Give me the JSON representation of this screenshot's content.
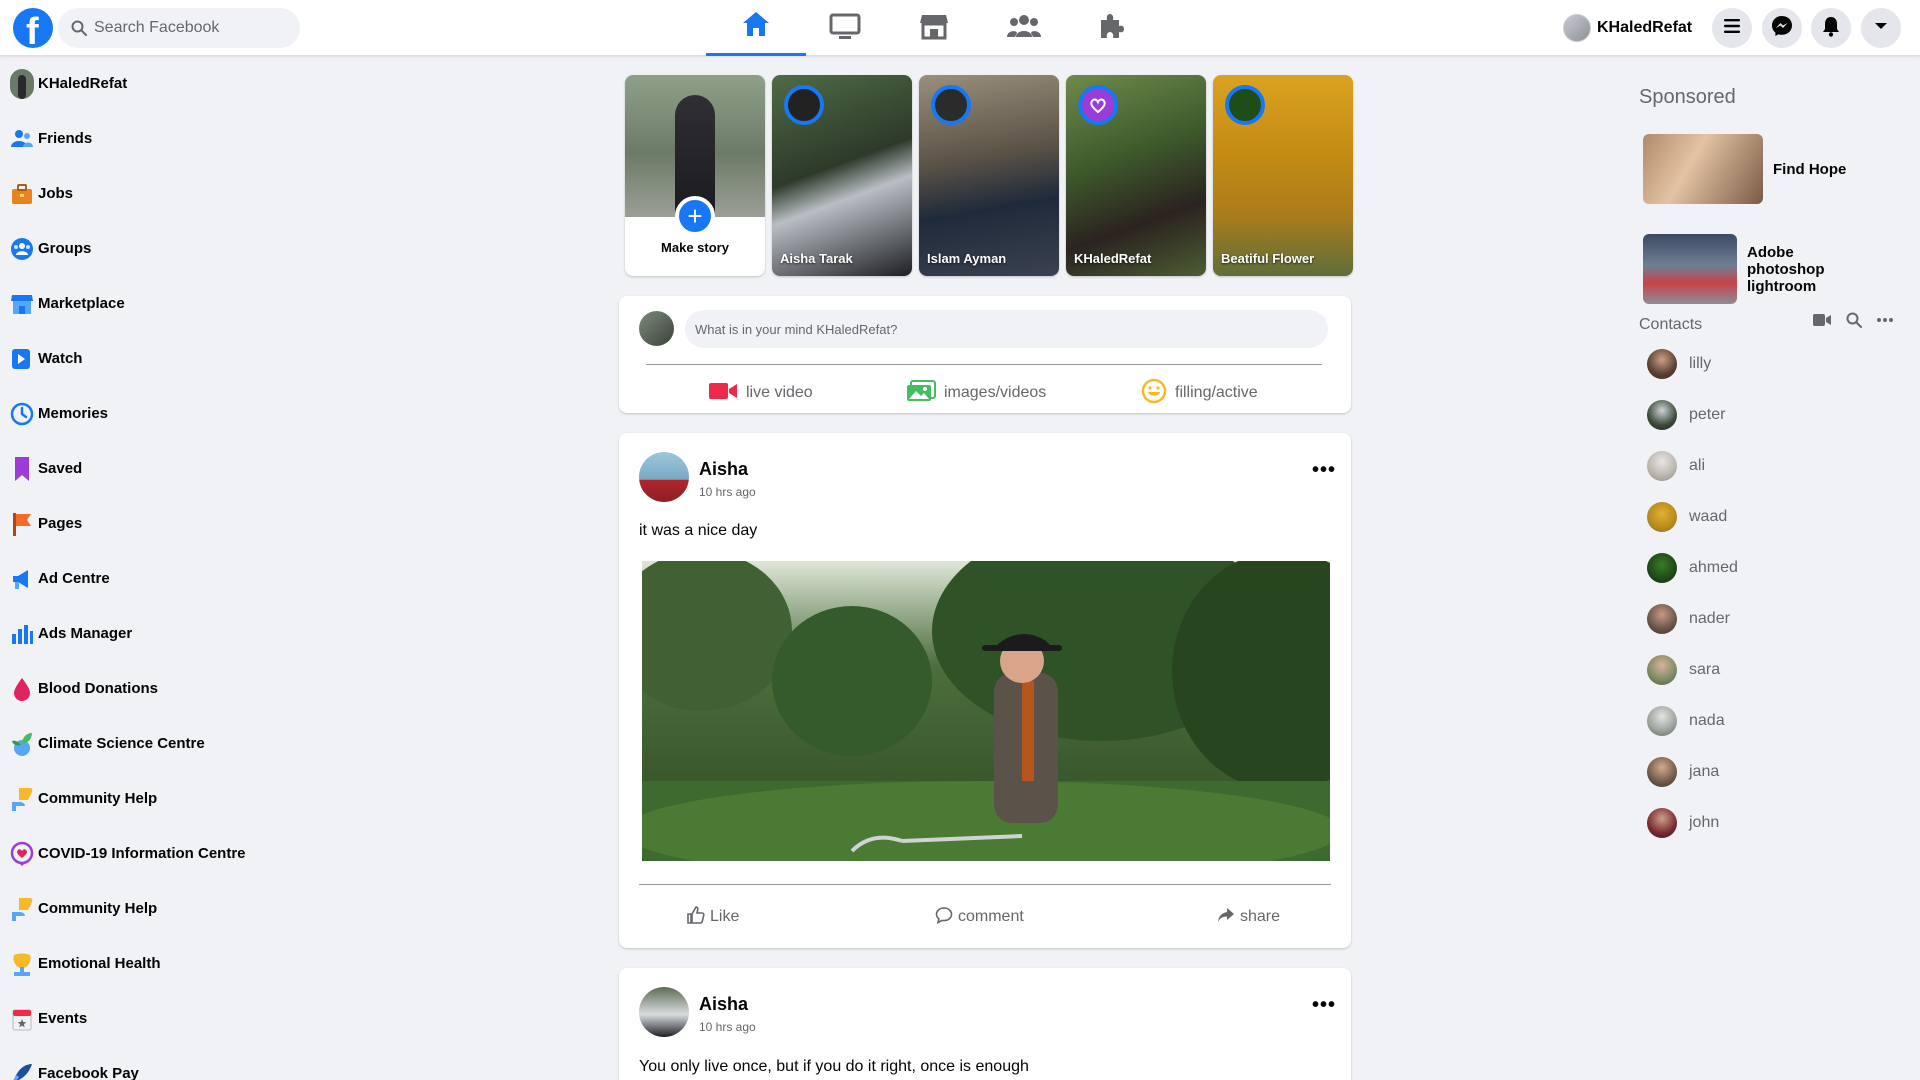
{
  "header": {
    "search_placeholder": "Search Facebook",
    "user_name": "KHaledRefat",
    "avatar_alt": "isp",
    "brand_color": "#1877f2"
  },
  "nav_tabs": [
    {
      "name": "home",
      "icon": "home-icon",
      "active": true
    },
    {
      "name": "watch",
      "icon": "monitor-icon",
      "active": false
    },
    {
      "name": "marketplace",
      "icon": "store-icon",
      "active": false
    },
    {
      "name": "groups",
      "icon": "people-icon",
      "active": false
    },
    {
      "name": "gaming",
      "icon": "puzzle-icon",
      "active": false
    }
  ],
  "sidebar": {
    "items": [
      {
        "label": "KHaledRefat",
        "icon": "avatar"
      },
      {
        "label": "Friends",
        "icon": "friends-icon"
      },
      {
        "label": "Jobs",
        "icon": "briefcase-icon"
      },
      {
        "label": "Groups",
        "icon": "groups-icon"
      },
      {
        "label": "Marketplace",
        "icon": "store-icon"
      },
      {
        "label": "Watch",
        "icon": "watch-icon"
      },
      {
        "label": "Memories",
        "icon": "clock-icon"
      },
      {
        "label": "Saved",
        "icon": "bookmark-icon"
      },
      {
        "label": "Pages",
        "icon": "flag-icon"
      },
      {
        "label": "Ad Centre",
        "icon": "megaphone-icon"
      },
      {
        "label": "Ads Manager",
        "icon": "bar-chart-icon"
      },
      {
        "label": "Blood Donations",
        "icon": "blood-drop-icon"
      },
      {
        "label": "Climate Science Centre",
        "icon": "leaf-icon"
      },
      {
        "label": "Community Help",
        "icon": "hand-heart-icon"
      },
      {
        "label": "COVID-19 Information Centre",
        "icon": "heart-icon"
      },
      {
        "label": "Community Help",
        "icon": "hand-heart-icon"
      },
      {
        "label": "Emotional Health",
        "icon": "flower-icon"
      },
      {
        "label": "Events",
        "icon": "calendar-icon"
      },
      {
        "label": "Facebook Pay",
        "icon": "pay-icon"
      }
    ]
  },
  "stories": {
    "make_story_label": "Make story",
    "items": [
      {
        "name": "Aisha Tarak"
      },
      {
        "name": "Islam Ayman"
      },
      {
        "name": "KHaledRefat"
      },
      {
        "name": "Beatiful Flower"
      }
    ]
  },
  "composer": {
    "placeholder": "What is in your mind KHaledRefat?",
    "actions": [
      {
        "label": "live video",
        "icon": "video-camera-icon",
        "color": "#f02849"
      },
      {
        "label": "images/videos",
        "icon": "photo-icon",
        "color": "#45bd62"
      },
      {
        "label": "filling/active",
        "icon": "smile-icon",
        "color": "#f7b928"
      }
    ]
  },
  "posts": [
    {
      "author": "Aisha",
      "time": "10 hrs ago",
      "text": "it was a nice day",
      "actions": [
        {
          "label": "Like",
          "icon": "thumbs-up-icon"
        },
        {
          "label": "comment",
          "icon": "comment-icon"
        },
        {
          "label": "share",
          "icon": "share-icon"
        }
      ]
    },
    {
      "author": "Aisha",
      "time": "10 hrs ago",
      "text": "You only live once, but if you do it right, once is enough"
    }
  ],
  "sponsored": {
    "title": "Sponsored",
    "items": [
      {
        "label": "Find Hope"
      },
      {
        "label": "Adobe photoshop lightroom"
      }
    ]
  },
  "contacts": {
    "title": "Contacts",
    "items": [
      {
        "name": "lilly"
      },
      {
        "name": "peter"
      },
      {
        "name": "ali"
      },
      {
        "name": "waad"
      },
      {
        "name": "ahmed"
      },
      {
        "name": "nader"
      },
      {
        "name": "sara"
      },
      {
        "name": "nada"
      },
      {
        "name": "jana"
      },
      {
        "name": "john"
      }
    ]
  }
}
